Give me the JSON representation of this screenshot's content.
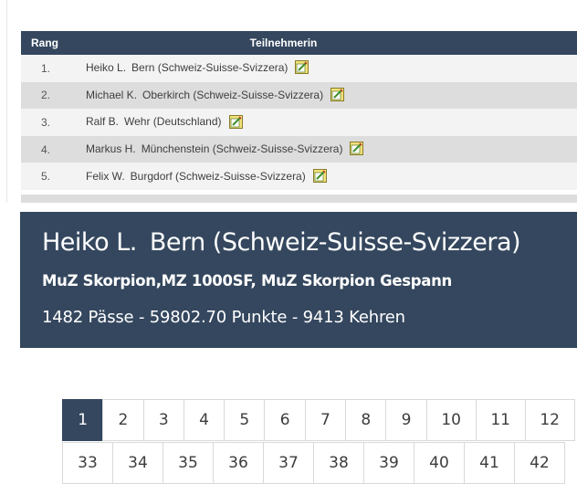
{
  "ranking": {
    "headers": {
      "rang": "Rang",
      "participant": "Teilnehmerin"
    },
    "rows": [
      {
        "rank": "1.",
        "name": "Heiko L.",
        "location": "Bern (Schweiz-Suisse-Svizzera)"
      },
      {
        "rank": "2.",
        "name": "Michael K.",
        "location": "Oberkirch (Schweiz-Suisse-Svizzera)"
      },
      {
        "rank": "3.",
        "name": "Ralf B.",
        "location": "Wehr (Deutschland)"
      },
      {
        "rank": "4.",
        "name": "Markus H.",
        "location": "Münchenstein (Schweiz-Suisse-Svizzera)"
      },
      {
        "rank": "5.",
        "name": "Felix W.",
        "location": "Burgdorf (Schweiz-Suisse-Svizzera)"
      }
    ]
  },
  "detail": {
    "name": "Heiko L.",
    "location": "Bern (Schweiz-Suisse-Svizzera)",
    "vehicles": "MuZ Skorpion,MZ 1000SF, MuZ Skorpion Gespann",
    "stats": "1482 Pässe - 59802.70 Punkte - 9413 Kehren"
  },
  "pagination": {
    "active": "1",
    "row1": [
      "1",
      "2",
      "3",
      "4",
      "5",
      "6",
      "7",
      "8",
      "9",
      "10",
      "11",
      "12"
    ],
    "row2": [
      "33",
      "34",
      "35",
      "36",
      "37",
      "38",
      "39",
      "40",
      "41",
      "42"
    ]
  },
  "colors": {
    "header_bg": "#34475e",
    "row_alt": "#dddddd",
    "row": "#f3f3f3"
  },
  "icons": {
    "row_action": "edit-note-icon"
  }
}
